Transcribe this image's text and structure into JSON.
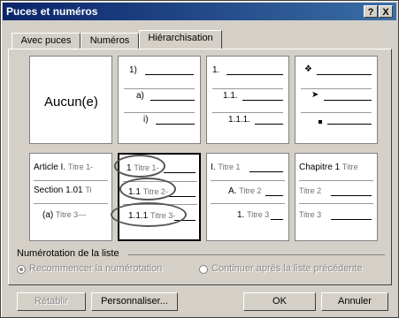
{
  "title": "Puces et numéros",
  "titlebar_help": "?",
  "titlebar_close": "X",
  "tabs": [
    "Avec puces",
    "Numéros",
    "Hiérarchisation"
  ],
  "none_label": "Aucun(e)",
  "grid": {
    "cell2": [
      "1)",
      "a)",
      "i)"
    ],
    "cell3": [
      "1.",
      "1.1.",
      "1.1.1."
    ],
    "cell4_icons": [
      "diamond-bullet-icon",
      "arrow-bullet-icon",
      "square-bullet-icon"
    ],
    "cell5": [
      [
        "Article I.",
        "Titre 1-"
      ],
      [
        "Section 1.01",
        "Ti"
      ],
      [
        "(a)",
        "Titre 3—"
      ]
    ],
    "cell6": [
      [
        "1",
        "Titre 1-"
      ],
      [
        "1.1",
        "Titre 2-"
      ],
      [
        "1.1.1",
        "Titre 3-"
      ]
    ],
    "cell7": [
      [
        "I.",
        "Titre 1"
      ],
      [
        "A.",
        "Titre 2"
      ],
      [
        "1.",
        "Titre 3"
      ]
    ],
    "cell8": [
      [
        "Chapitre 1",
        "Titre"
      ],
      [
        "",
        "Titre 2"
      ],
      [
        "",
        "Titre 3"
      ]
    ]
  },
  "numbering_group": "Numérotation de la liste",
  "radio_restart": "Recommencer la numérotation",
  "radio_continue": "Continuer après la liste précédente",
  "buttons": {
    "reset": "Rétablir",
    "customize": "Personnaliser...",
    "ok": "OK",
    "cancel": "Annuler"
  }
}
